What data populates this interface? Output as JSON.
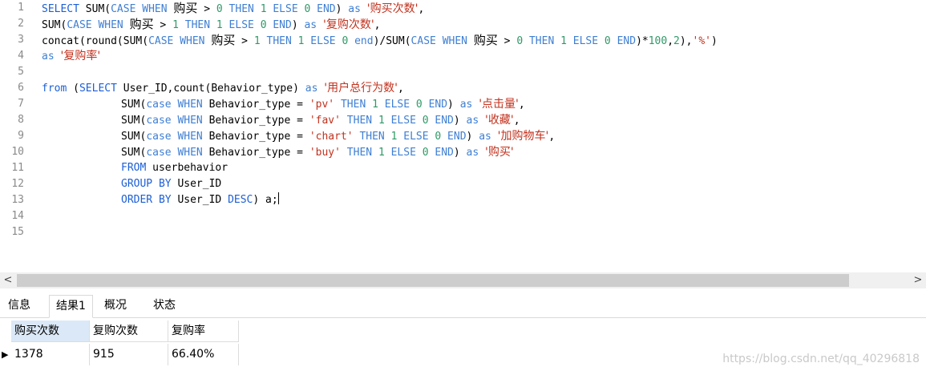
{
  "editor": {
    "line_numbers": [
      "1",
      "2",
      "3",
      "4",
      "5",
      "6",
      "7",
      "8",
      "9",
      "10",
      "11",
      "12",
      "13",
      "14",
      "15"
    ]
  },
  "tabs": [
    "信息",
    "结果1",
    "概况",
    "状态"
  ],
  "result_table": {
    "headers": [
      "购买次数",
      "复购次数",
      "复购率"
    ],
    "rows": [
      [
        "1378",
        "915",
        "66.40%"
      ]
    ]
  },
  "watermark": "https://blog.csdn.net/qq_40296818",
  "scrollbar": {
    "left_arrow": "<",
    "right_arrow": ">"
  }
}
